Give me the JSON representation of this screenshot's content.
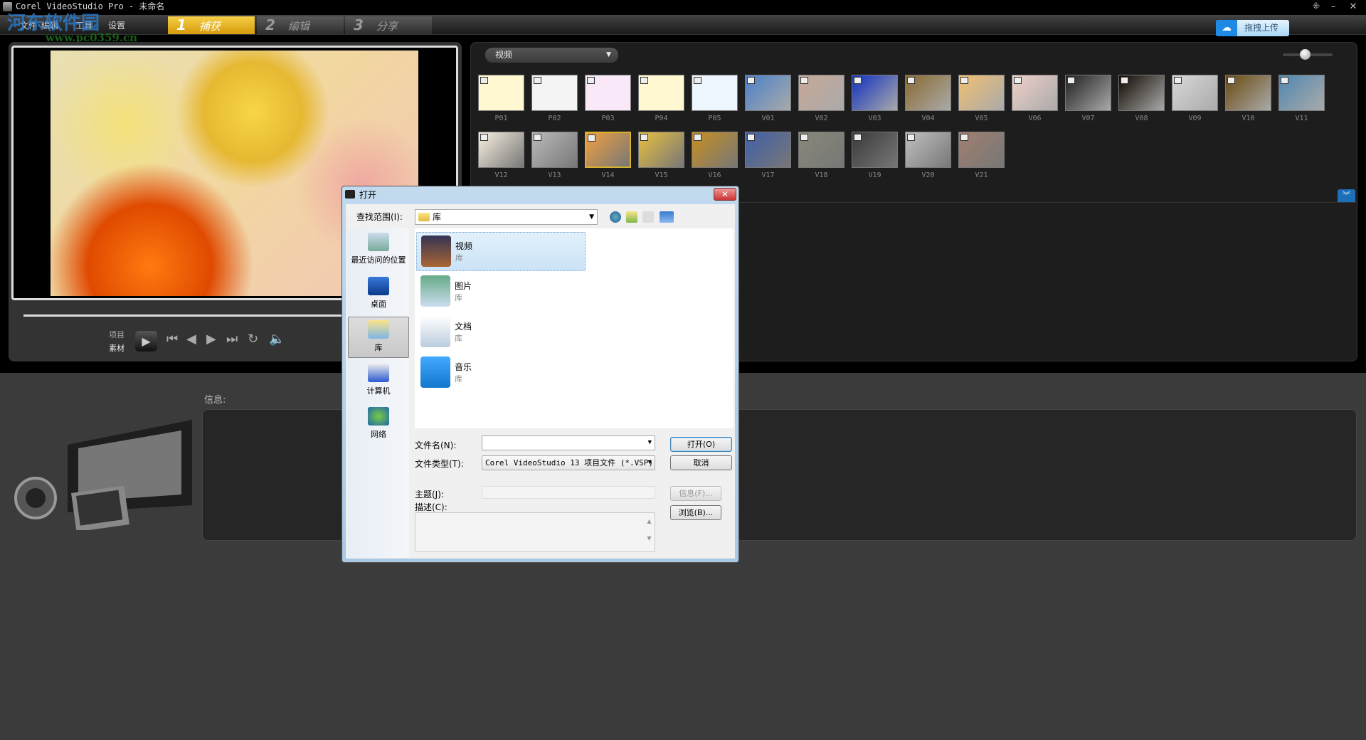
{
  "window": {
    "title": "Corel VideoStudio Pro - 未命名"
  },
  "watermark": {
    "text": "河东软件园",
    "url": "www.pc0359.cn"
  },
  "menu": [
    "文件",
    "编辑",
    "工具",
    "设置"
  ],
  "tabs": [
    {
      "num": "1",
      "label": "捕获",
      "active": true
    },
    {
      "num": "2",
      "label": "编辑"
    },
    {
      "num": "3",
      "label": "分享"
    }
  ],
  "upload_button": "拖拽上传",
  "player": {
    "mode_project": "项目",
    "mode_clip": "素材"
  },
  "library": {
    "category": "视频",
    "zoom_level": 0.4,
    "thumbnails": [
      "P01",
      "P02",
      "P03",
      "P04",
      "P05",
      "V01",
      "V02",
      "V03",
      "V04",
      "V05",
      "V06",
      "V07",
      "V08",
      "V09",
      "V10",
      "V11",
      "V12",
      "V13",
      "V14",
      "V15",
      "V16",
      "V17",
      "V18",
      "V19",
      "V20",
      "V21"
    ],
    "selected": "V14",
    "thumb_colors": [
      "#fff8d0",
      "#f4f4f4",
      "#f8e8f8",
      "#fff8d0",
      "#eef6ff",
      "#4a80c8",
      "#c8a898",
      "#1030c0",
      "#8a6a30",
      "#f0c070",
      "#f0d0c8",
      "#202020",
      "#100800",
      "#d8d8d8",
      "#6a4a10",
      "#5088b0",
      "#f8f0e0",
      "#bbbbbb",
      "#f0a040",
      "#e8c040",
      "#c89020",
      "#4060a8",
      "#888878",
      "#3a3a3a",
      "#c0c0c0",
      "#a08070"
    ]
  },
  "info": {
    "label": "信息:"
  },
  "dialog": {
    "title": "打开",
    "look_in_label": "查找范围(I):",
    "look_in_value": "库",
    "places": [
      "最近访问的位置",
      "桌面",
      "库",
      "计算机",
      "网络"
    ],
    "selected_place": "库",
    "files": [
      {
        "name": "视频",
        "type": "库"
      },
      {
        "name": "图片",
        "type": "库"
      },
      {
        "name": "文档",
        "type": "库"
      },
      {
        "name": "音乐",
        "type": "库"
      }
    ],
    "file_name_label": "文件名(N):",
    "file_name_value": "",
    "file_type_label": "文件类型(T):",
    "file_type_value": "Corel VideoStudio 13 项目文件 (*.VSP)",
    "subject_label": "主题(J):",
    "description_label": "描述(C):",
    "open_button": "打开(O)",
    "cancel_button": "取消",
    "info_button": "信息(F)...",
    "browse_button": "浏览(B)..."
  }
}
